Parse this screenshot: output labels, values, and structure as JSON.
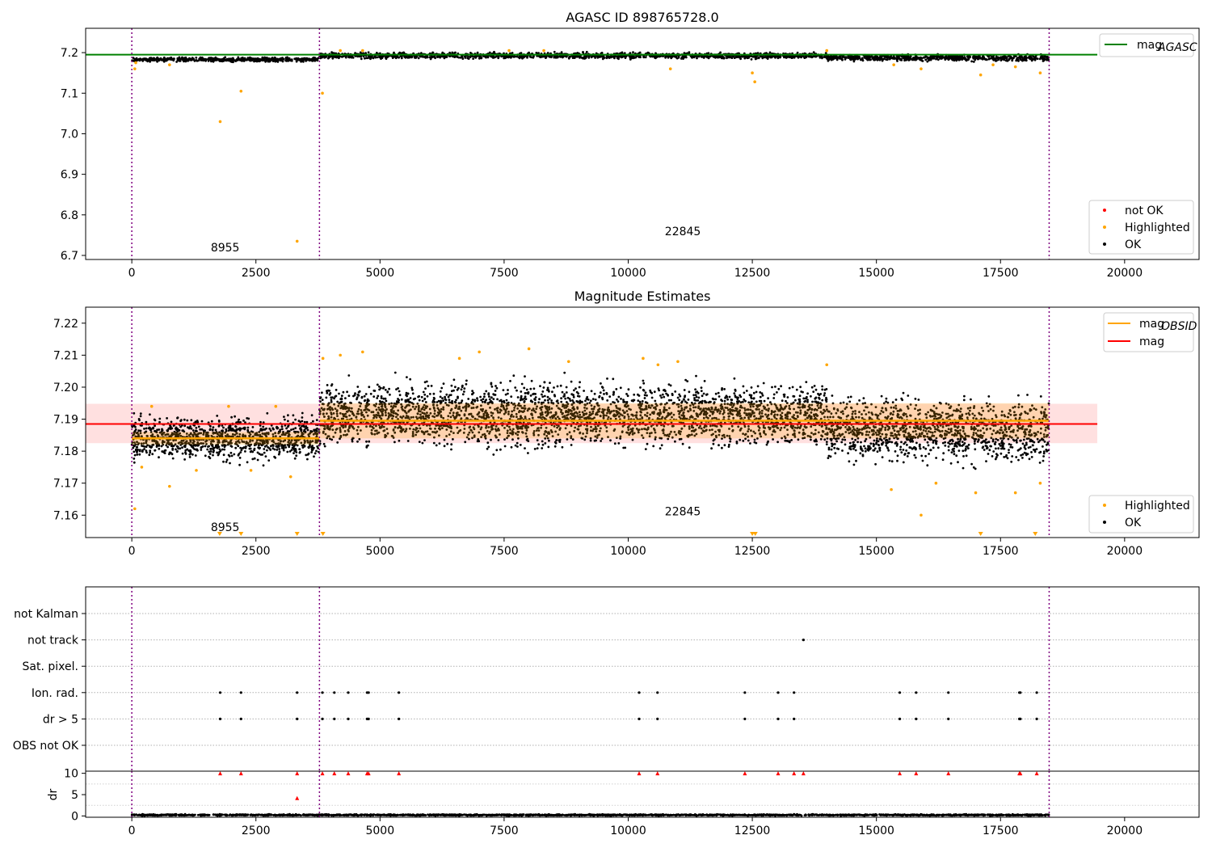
{
  "chart_data": [
    {
      "type": "scatter",
      "title": "AGASC ID 898765728.0",
      "xlim": [
        -930,
        21500
      ],
      "ylim": [
        6.69,
        7.26
      ],
      "xticks": [
        0,
        2500,
        5000,
        7500,
        10000,
        12500,
        15000,
        17500,
        20000
      ],
      "yticks": [
        6.7,
        6.8,
        6.9,
        7.0,
        7.1,
        7.2
      ],
      "ytick_labels": [
        "6.7",
        "6.8",
        "6.9",
        "7.0",
        "7.1",
        "7.2"
      ],
      "obs_boundaries": [
        0,
        3780,
        18480
      ],
      "obs_labels": [
        {
          "text": "8955",
          "x": 1880,
          "y": 6.71
        },
        {
          "text": "22845",
          "x": 11100,
          "y": 6.75
        }
      ],
      "reference_line": {
        "name_main": "mag",
        "name_sub": "AGASC",
        "y": 7.195,
        "x_end": 19450,
        "color": "#008000"
      },
      "legend_lines": [
        {
          "main": "mag",
          "sub": "AGASC",
          "color": "#008000"
        }
      ],
      "legend_points": [
        {
          "name": "not OK",
          "color": "#ff0000"
        },
        {
          "name": "Highlighted",
          "color": "#ffa500"
        },
        {
          "name": "OK",
          "color": "#000000"
        }
      ],
      "highlighted_points": [
        [
          60,
          7.16
        ],
        [
          80,
          7.175
        ],
        [
          760,
          7.17
        ],
        [
          1780,
          7.03
        ],
        [
          2200,
          7.105
        ],
        [
          3330,
          6.735
        ],
        [
          3840,
          7.1
        ],
        [
          4200,
          7.205
        ],
        [
          4650,
          7.205
        ],
        [
          7600,
          7.205
        ],
        [
          8300,
          7.205
        ],
        [
          10850,
          7.16
        ],
        [
          12500,
          7.15
        ],
        [
          12550,
          7.128
        ],
        [
          14000,
          7.205
        ],
        [
          15350,
          7.17
        ],
        [
          15900,
          7.16
        ],
        [
          17100,
          7.145
        ],
        [
          17350,
          7.17
        ],
        [
          17800,
          7.165
        ],
        [
          18300,
          7.15
        ]
      ],
      "band_points": {
        "name": "OK",
        "color": "#000000",
        "segments": [
          {
            "x0": 0,
            "x1": 3780,
            "y0": 7.176,
            "y1": 7.19
          },
          {
            "x0": 3780,
            "x1": 14000,
            "y0": 7.182,
            "y1": 7.203
          },
          {
            "x0": 14000,
            "x1": 18480,
            "y0": 7.176,
            "y1": 7.198
          }
        ]
      }
    },
    {
      "type": "scatter",
      "title": "Magnitude Estimates",
      "xlim": [
        -930,
        21500
      ],
      "ylim": [
        7.153,
        7.225
      ],
      "xticks": [
        0,
        2500,
        5000,
        7500,
        10000,
        12500,
        15000,
        17500,
        20000
      ],
      "yticks": [
        7.16,
        7.17,
        7.18,
        7.19,
        7.2,
        7.21,
        7.22
      ],
      "ytick_labels": [
        "7.16",
        "7.17",
        "7.18",
        "7.19",
        "7.20",
        "7.21",
        "7.22"
      ],
      "obs_boundaries": [
        0,
        3780,
        18480
      ],
      "obs_labels": [
        {
          "text": "8955",
          "x": 1880,
          "y": 7.155
        },
        {
          "text": "22845",
          "x": 11100,
          "y": 7.16
        }
      ],
      "mag_line": {
        "y": 7.1885,
        "x_end": 19450,
        "color": "#ff0000",
        "band": [
          7.1825,
          7.1948
        ],
        "band_color": "#ffcccc"
      },
      "obsid_lines": [
        {
          "x0": 0,
          "x1": 3780,
          "y": 7.184,
          "band": [
            7.182,
            7.186
          ]
        },
        {
          "x0": 3780,
          "x1": 18480,
          "y": 7.1895,
          "band": [
            7.184,
            7.195
          ]
        }
      ],
      "obsid_color": "#ffa500",
      "legend_lines": [
        {
          "main": "mag",
          "sub": "OBSID",
          "color": "#ffa500"
        },
        {
          "main": "mag",
          "sub": "",
          "color": "#ff0000"
        }
      ],
      "legend_points": [
        {
          "name": "Highlighted",
          "color": "#ffa500"
        },
        {
          "name": "OK",
          "color": "#000000"
        }
      ],
      "highlighted_points": [
        [
          60,
          7.162
        ],
        [
          200,
          7.175
        ],
        [
          400,
          7.194
        ],
        [
          760,
          7.169
        ],
        [
          1300,
          7.174
        ],
        [
          1950,
          7.194
        ],
        [
          2400,
          7.174
        ],
        [
          2900,
          7.194
        ],
        [
          3200,
          7.172
        ],
        [
          3850,
          7.209
        ],
        [
          4200,
          7.21
        ],
        [
          4650,
          7.211
        ],
        [
          6600,
          7.209
        ],
        [
          7000,
          7.211
        ],
        [
          8000,
          7.212
        ],
        [
          8800,
          7.208
        ],
        [
          10300,
          7.209
        ],
        [
          10600,
          7.207
        ],
        [
          11000,
          7.208
        ],
        [
          14000,
          7.207
        ],
        [
          15300,
          7.168
        ],
        [
          15900,
          7.16
        ],
        [
          16200,
          7.17
        ],
        [
          17000,
          7.167
        ],
        [
          17800,
          7.167
        ],
        [
          18300,
          7.17
        ]
      ],
      "clipped_points": [
        1770,
        2200,
        3330,
        3850,
        12500,
        12560,
        17100,
        18200
      ],
      "band_points": {
        "name": "OK",
        "color": "#000000",
        "segments": [
          {
            "x0": 0,
            "x1": 3780,
            "y0": 7.175,
            "y1": 7.193
          },
          {
            "x0": 3780,
            "x1": 14000,
            "y0": 7.178,
            "y1": 7.205
          },
          {
            "x0": 14000,
            "x1": 18480,
            "y0": 7.173,
            "y1": 7.2
          }
        ]
      }
    },
    {
      "type": "scatter",
      "title": "",
      "xlim": [
        -930,
        21500
      ],
      "categories": [
        "not Kalman",
        "not track",
        "Sat. pixel.",
        "Ion. rad.",
        "dr > 5",
        "OBS not OK"
      ],
      "obs_boundaries": [
        0,
        3780,
        18480
      ],
      "flag_points": {
        "not track": [
          13530
        ],
        "Ion. rad.": [
          1780,
          2200,
          3330,
          3840,
          4080,
          4360,
          4740,
          4770,
          5380,
          10220,
          10590,
          12350,
          13020,
          13340,
          15470,
          15800,
          16450,
          17880,
          17900,
          18230
        ],
        "dr > 5": [
          1780,
          2200,
          3330,
          3840,
          4080,
          4360,
          4740,
          4770,
          5380,
          10220,
          10590,
          12350,
          13020,
          13340,
          15470,
          15800,
          16450,
          17880,
          17900,
          18230
        ]
      }
    },
    {
      "type": "scatter",
      "title": "",
      "xlim": [
        -930,
        21500
      ],
      "ylim": [
        -0.3,
        10.5
      ],
      "ylabel": "dr",
      "yticks": [
        0,
        5,
        10
      ],
      "ytick_labels": [
        "0",
        "5",
        "10"
      ],
      "xticks": [
        0,
        2500,
        5000,
        7500,
        10000,
        12500,
        15000,
        17500,
        20000
      ],
      "xtick_labels": [
        "0",
        "2500",
        "5000",
        "7500",
        "10000",
        "12500",
        "15000",
        "17500",
        "20000"
      ],
      "obs_boundaries": [
        0,
        3780,
        18480
      ],
      "red_markers": [
        [
          1780,
          10
        ],
        [
          2200,
          10
        ],
        [
          3330,
          10
        ],
        [
          3330,
          4.2
        ],
        [
          3840,
          10
        ],
        [
          4080,
          10
        ],
        [
          4360,
          10
        ],
        [
          4740,
          10
        ],
        [
          4770,
          10
        ],
        [
          5380,
          10
        ],
        [
          10220,
          10
        ],
        [
          10590,
          10
        ],
        [
          12350,
          10
        ],
        [
          13020,
          10
        ],
        [
          13340,
          10
        ],
        [
          13530,
          10
        ],
        [
          15470,
          10
        ],
        [
          15800,
          10
        ],
        [
          16450,
          10
        ],
        [
          17880,
          10
        ],
        [
          17900,
          10
        ],
        [
          18230,
          10
        ]
      ],
      "band_points": {
        "name": "OK",
        "color": "#000000",
        "segments": [
          {
            "x0": 0,
            "x1": 18480,
            "y0": 0,
            "y1": 0.45
          }
        ]
      }
    }
  ]
}
